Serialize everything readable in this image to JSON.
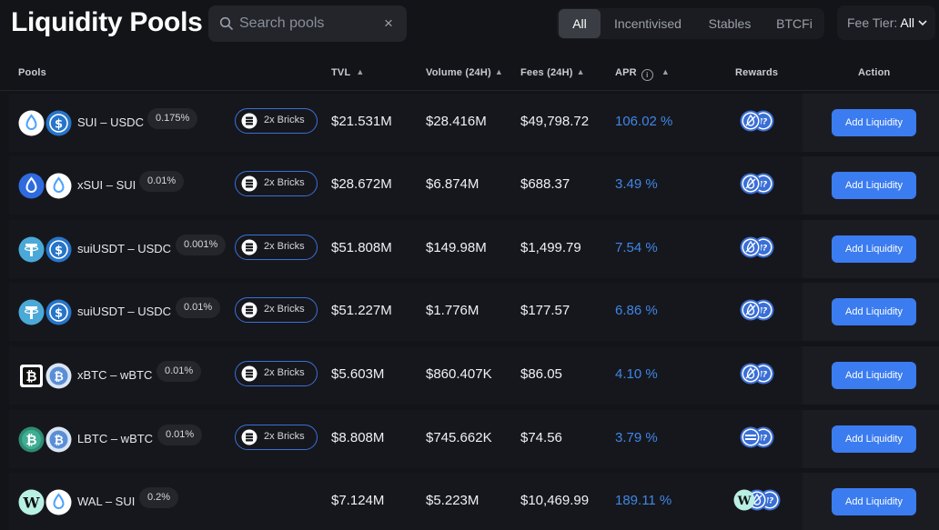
{
  "page": {
    "title": "Liquidity Pools"
  },
  "search": {
    "placeholder": "Search pools",
    "clear_label": "×"
  },
  "filters": [
    {
      "label": "All",
      "active": true
    },
    {
      "label": "Incentivised",
      "active": false
    },
    {
      "label": "Stables",
      "active": false
    },
    {
      "label": "BTCFi",
      "active": false
    }
  ],
  "fee_tier": {
    "label": "Fee Tier:",
    "value": "All"
  },
  "columns": {
    "pools": "Pools",
    "tvl": "TVL",
    "volume": "Volume (24H)",
    "fees": "Fees (24H)",
    "apr": "APR",
    "rewards": "Rewards",
    "action": "Action",
    "sort_glyph": "▲",
    "info_glyph": "i"
  },
  "action_label": "Add Liquidity",
  "bricks_label": "2x Bricks",
  "rows": [
    {
      "pair": "SUI – USDC",
      "fee": "0.175%",
      "bricks": true,
      "tvl": "$21.531M",
      "volume": "$28.416M",
      "fees": "$49,798.72",
      "apr": "106.02 %",
      "tokens": [
        "sui-icon",
        "usdc-icon"
      ],
      "rewards": [
        "sui-reward-icon",
        "protocol-reward-icon"
      ]
    },
    {
      "pair": "xSUI – SUI",
      "fee": "0.01%",
      "bricks": true,
      "tvl": "$28.672M",
      "volume": "$6.874M",
      "fees": "$688.37",
      "apr": "3.49 %",
      "tokens": [
        "xsui-icon",
        "sui-icon"
      ],
      "rewards": [
        "sui-reward-icon",
        "protocol-reward-icon"
      ]
    },
    {
      "pair": "suiUSDT – USDC",
      "fee": "0.001%",
      "bricks": true,
      "tvl": "$51.808M",
      "volume": "$149.98M",
      "fees": "$1,499.79",
      "apr": "7.54 %",
      "tokens": [
        "usdt-icon",
        "usdc-icon"
      ],
      "rewards": [
        "sui-reward-icon",
        "protocol-reward-icon"
      ]
    },
    {
      "pair": "suiUSDT – USDC",
      "fee": "0.01%",
      "bricks": true,
      "tvl": "$51.227M",
      "volume": "$1.776M",
      "fees": "$177.57",
      "apr": "6.86 %",
      "tokens": [
        "usdt-icon",
        "usdc-icon"
      ],
      "rewards": [
        "sui-reward-icon",
        "protocol-reward-icon"
      ]
    },
    {
      "pair": "xBTC – wBTC",
      "fee": "0.01%",
      "bricks": true,
      "tvl": "$5.603M",
      "volume": "$860.407K",
      "fees": "$86.05",
      "apr": "4.10 %",
      "tokens": [
        "xbtc-icon",
        "wbtc-icon"
      ],
      "rewards": [
        "sui-reward-icon",
        "protocol-reward-icon"
      ]
    },
    {
      "pair": "LBTC – wBTC",
      "fee": "0.01%",
      "bricks": true,
      "tvl": "$8.808M",
      "volume": "$745.662K",
      "fees": "$74.56",
      "apr": "3.79 %",
      "tokens": [
        "lbtc-icon",
        "wbtc-icon"
      ],
      "rewards": [
        "stripe-reward-icon",
        "protocol-reward-icon"
      ]
    },
    {
      "pair": "WAL – SUI",
      "fee": "0.2%",
      "bricks": false,
      "tvl": "$7.124M",
      "volume": "$5.223M",
      "fees": "$10,469.99",
      "apr": "189.11 %",
      "tokens": [
        "wal-icon",
        "sui-icon"
      ],
      "rewards": [
        "wal-reward-icon",
        "sui-reward-icon",
        "protocol-reward-icon"
      ]
    }
  ],
  "colors": {
    "background": "#131418",
    "row": "#16171c",
    "accent": "#3b7cf0",
    "apr_text": "#3f86e8",
    "bricks_border": "#3b6fd8"
  }
}
